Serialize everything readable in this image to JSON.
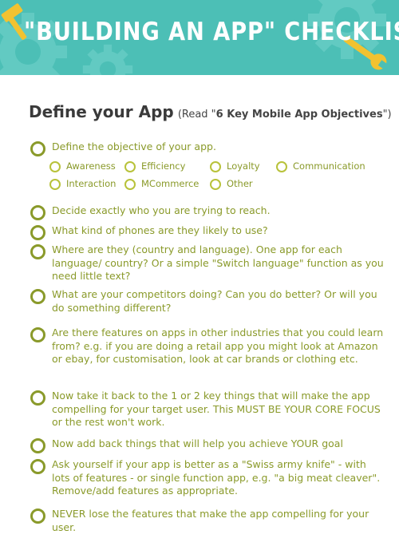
{
  "banner": {
    "title": "\"BUILDING AN APP\" CHECKLIST",
    "background_color": "#4cbfb6",
    "icons": [
      "gear-icon",
      "hammer-icon",
      "wrench-icon"
    ]
  },
  "section": {
    "title": "Define your App",
    "note_prefix": "(Read \"",
    "note_bold": "6 Key Mobile App Objectives",
    "note_suffix": "\")"
  },
  "accent_color": "#8a9a2a",
  "items": [
    {
      "text": "Define the objective of your app."
    },
    {
      "text": "Decide exactly who you are trying to reach."
    },
    {
      "text": "What kind of phones are they likely to use?"
    },
    {
      "text": "Where are they (country and language). One app for each language/ country? Or a simple \"Switch language\" function as you need little text?"
    },
    {
      "text": "What are your competitors doing? Can you do better? Or will you do something different?"
    },
    {
      "text": "Are there features on apps in other industries that you could learn from? e.g. if you are doing a retail app you might look at Amazon or ebay,  for customisation, look at car brands or clothing etc."
    },
    {
      "text": "Now take it back to the 1 or 2 key things that will make the app compelling for your target user. This MUST BE YOUR CORE FOCUS or the rest won't work."
    },
    {
      "text": "Now add back things that will help you achieve YOUR goal"
    },
    {
      "text": "Ask yourself if your app is better as a \"Swiss army knife\" - with lots of features - or single function app, e.g. \"a big meat cleaver\". Remove/add features as appropriate."
    },
    {
      "text": "NEVER  lose the features that make the app compelling for your user."
    }
  ],
  "objectives": [
    "Awareness",
    "Efficiency",
    "Loyalty",
    "Communication",
    "Interaction",
    "MCommerce",
    "Other"
  ]
}
